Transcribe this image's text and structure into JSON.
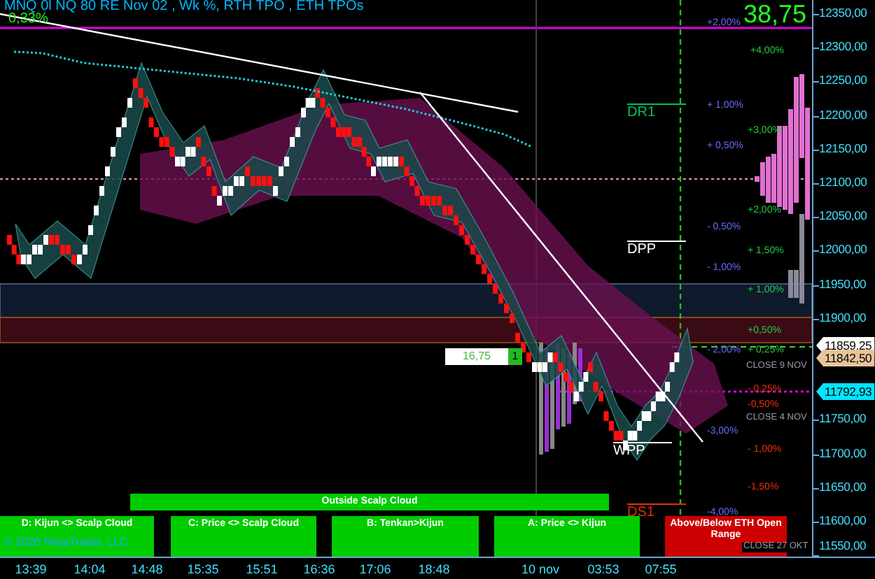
{
  "chart": {
    "title": "MNQ 0l NQ 80 RE Nov 02 , Wk %, RTH TPO , ETH TPOs",
    "change": "0,33%",
    "reading": "38,75",
    "pivots": [
      {
        "label": "DR1",
        "color": "#00c060"
      },
      {
        "label": "DPP",
        "color": "#ffffff"
      },
      {
        "label": "WPP",
        "color": "#ffffff"
      },
      {
        "label": "DS1",
        "color": "#e03000"
      }
    ],
    "percent_labels": [
      {
        "text": "+2,00%",
        "color": "#6a6aff"
      },
      {
        "text": "+4,00%",
        "color": "#22cc44"
      },
      {
        "text": "+ 1,00%",
        "color": "#6a6aff"
      },
      {
        "text": "+3,00%",
        "color": "#22cc44"
      },
      {
        "text": "+ 0,50%",
        "color": "#6a6aff"
      },
      {
        "text": "+2,00%",
        "color": "#22cc44"
      },
      {
        "text": "- 0,50%",
        "color": "#6a6aff"
      },
      {
        "text": "+ 1,50%",
        "color": "#22cc44"
      },
      {
        "text": "- 1,00%",
        "color": "#6a6aff"
      },
      {
        "text": "+ 1,00%",
        "color": "#22cc44"
      },
      {
        "text": "+0,50%",
        "color": "#22cc44"
      },
      {
        "text": "- 2,00%",
        "color": "#6a6aff"
      },
      {
        "text": "+ 0,25%",
        "color": "#22cc44"
      },
      {
        "text": "- 0,25%",
        "color": "#ee3300"
      },
      {
        "text": "-0,50%",
        "color": "#ee3300"
      },
      {
        "text": "-3,00%",
        "color": "#6a6aff"
      },
      {
        "text": "- 1,00%",
        "color": "#ee3300"
      },
      {
        "text": "-1,50%",
        "color": "#ee3300"
      },
      {
        "text": "-4,00%",
        "color": "#6a6aff"
      }
    ],
    "close_labels": [
      "CLOSE 9 NOV",
      "CLOSE 4 NOV",
      "CLOSE 27 OKT"
    ],
    "position": {
      "price": "16,75",
      "quantity": "1"
    },
    "cloud_status": "Outside Scalp Cloud",
    "signals": [
      {
        "label": "D: Kijun <> Scalp Cloud",
        "color": "#00cc00"
      },
      {
        "label": "C: Price <> Scalp Cloud",
        "color": "#00cc00"
      },
      {
        "label": "B: Tenkan>Kijun",
        "color": "#00cc00"
      },
      {
        "label": "A: Price <> Kijun",
        "color": "#00cc00"
      },
      {
        "label": "Above/Below ETH Open Range",
        "color": "#cc0000"
      }
    ],
    "copyright": "© 2020 NinjaTrader, LLC"
  },
  "price_axis": {
    "ticks": [
      "12350,00",
      "12300,00",
      "12250,00",
      "12200,00",
      "12150,00",
      "12100,00",
      "12050,00",
      "12000,00",
      "11950,00",
      "11900,00",
      "11750,00",
      "11700,00",
      "11650,00",
      "11600,00",
      "11550,00"
    ],
    "markers": [
      {
        "label": "11859,25",
        "color": "#ffffff"
      },
      {
        "label": "11842,50",
        "color": "#e8c49a"
      },
      {
        "label": "11792,93",
        "color": "#00e5ff"
      }
    ]
  },
  "time_axis": {
    "ticks": [
      "13:39",
      "14:04",
      "14:48",
      "15:35",
      "15:51",
      "16:36",
      "17:06",
      "18:48",
      "10 nov",
      "03:53",
      "07:55"
    ]
  }
}
